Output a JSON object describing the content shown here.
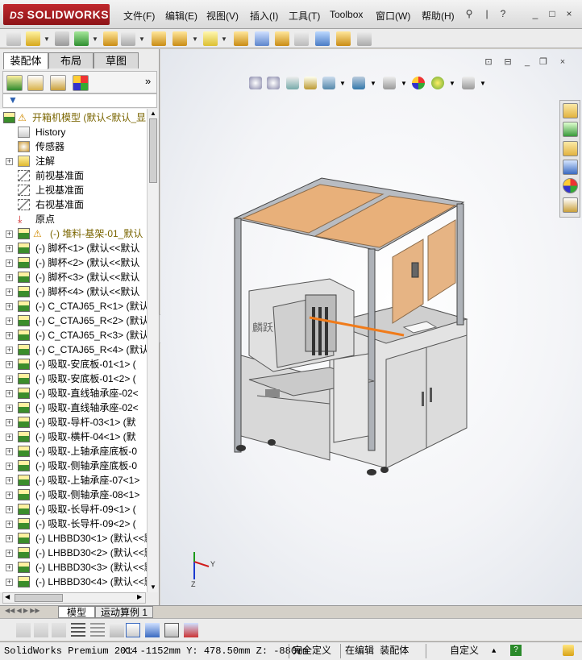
{
  "app": {
    "logo_text": "SOLIDWORKS",
    "logo_prefix": "DS",
    "window_controls": [
      "?",
      "_",
      "□",
      "×"
    ]
  },
  "menu": [
    "文件(F)",
    "编辑(E)",
    "视图(V)",
    "插入(I)",
    "工具(T)",
    "Toolbox",
    "窗口(W)",
    "帮助(H)"
  ],
  "left_tabs": [
    "装配体",
    "布局",
    "草图"
  ],
  "tree": {
    "root": "开箱机模型  (默认<默认_显",
    "items": [
      {
        "label": "History",
        "icon": "history-icon",
        "expand": false
      },
      {
        "label": "传感器",
        "icon": "sensor-icon",
        "expand": false
      },
      {
        "label": "注解",
        "icon": "annotation-icon",
        "expand": true
      },
      {
        "label": "前视基准面",
        "icon": "plane-icon",
        "expand": false
      },
      {
        "label": "上视基准面",
        "icon": "plane-icon",
        "expand": false
      },
      {
        "label": "右视基准面",
        "icon": "plane-icon",
        "expand": false
      },
      {
        "label": "原点",
        "icon": "origin-icon",
        "expand": false
      },
      {
        "label": "(-) 堆料-基架-01_默认",
        "icon": "assembly-icon",
        "expand": true,
        "warn": true
      },
      {
        "label": "(-) 脚杯<1> (默认<<默认",
        "icon": "assembly-icon",
        "expand": true
      },
      {
        "label": "(-) 脚杯<2> (默认<<默认",
        "icon": "assembly-icon",
        "expand": true
      },
      {
        "label": "(-) 脚杯<3> (默认<<默认",
        "icon": "assembly-icon",
        "expand": true
      },
      {
        "label": "(-) 脚杯<4> (默认<<默认",
        "icon": "assembly-icon",
        "expand": true
      },
      {
        "label": "(-) C_CTAJ65_R<1> (默认",
        "icon": "assembly-icon",
        "expand": true
      },
      {
        "label": "(-) C_CTAJ65_R<2> (默认",
        "icon": "assembly-icon",
        "expand": true
      },
      {
        "label": "(-) C_CTAJ65_R<3> (默认",
        "icon": "assembly-icon",
        "expand": true
      },
      {
        "label": "(-) C_CTAJ65_R<4> (默认",
        "icon": "assembly-icon",
        "expand": true
      },
      {
        "label": "(-) 吸取-安底板-01<1> (",
        "icon": "assembly-icon",
        "expand": true
      },
      {
        "label": "(-) 吸取-安底板-01<2> (",
        "icon": "assembly-icon",
        "expand": true
      },
      {
        "label": "(-) 吸取-直线轴承座-02<",
        "icon": "assembly-icon",
        "expand": true
      },
      {
        "label": "(-) 吸取-直线轴承座-02<",
        "icon": "assembly-icon",
        "expand": true
      },
      {
        "label": "(-) 吸取-导杆-03<1> (默",
        "icon": "assembly-icon",
        "expand": true
      },
      {
        "label": "(-) 吸取-横杆-04<1> (默",
        "icon": "assembly-icon",
        "expand": true
      },
      {
        "label": "(-) 吸取-上轴承座底板-0",
        "icon": "assembly-icon",
        "expand": true
      },
      {
        "label": "(-) 吸取-侧轴承座底板-0",
        "icon": "assembly-icon",
        "expand": true
      },
      {
        "label": "(-) 吸取-上轴承座-07<1>",
        "icon": "assembly-icon",
        "expand": true
      },
      {
        "label": "(-) 吸取-侧轴承座-08<1>",
        "icon": "assembly-icon",
        "expand": true
      },
      {
        "label": "(-) 吸取-长导杆-09<1> (",
        "icon": "assembly-icon",
        "expand": true
      },
      {
        "label": "(-) 吸取-长导杆-09<2> (",
        "icon": "assembly-icon",
        "expand": true
      },
      {
        "label": "(-) LHBBD30<1> (默认<<默",
        "icon": "assembly-icon",
        "expand": true
      },
      {
        "label": "(-) LHBBD30<2> (默认<<默",
        "icon": "assembly-icon",
        "expand": true
      },
      {
        "label": "(-) LHBBD30<3> (默认<<默",
        "icon": "assembly-icon",
        "expand": true
      },
      {
        "label": "(-) LHBBD30<4> (默认<<默",
        "icon": "assembly-icon",
        "expand": true
      }
    ]
  },
  "bottom_tabs": [
    "模型",
    "运动算例 1"
  ],
  "status": {
    "product": "SolidWorks Premium 2014",
    "coords": "X: -1152mm Y: 478.50mm Z: -880mm",
    "constraint": "完全定义",
    "editing": "在编辑 装配体",
    "units": "自定义"
  },
  "triad": {
    "x": "X",
    "y": "Y",
    "z": "Z"
  },
  "model_text": "麟跃"
}
